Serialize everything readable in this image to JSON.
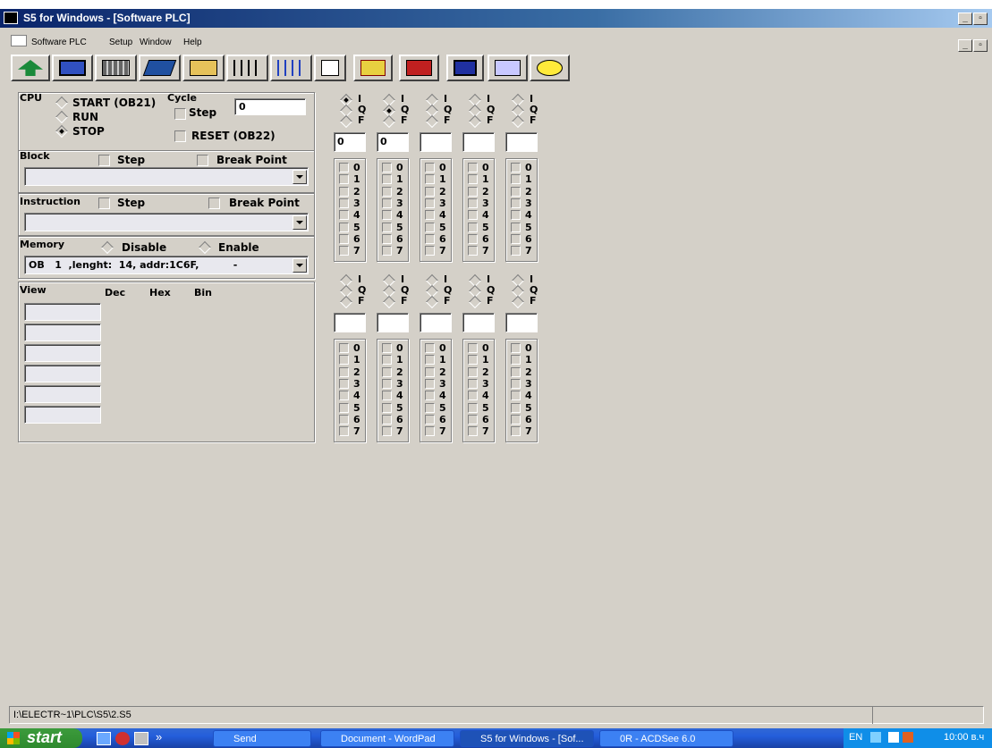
{
  "window": {
    "title": "S5 for Windows - [Software PLC]"
  },
  "menu": [
    "Software PLC",
    "Setup",
    "Window",
    "Help"
  ],
  "toolbar_icons": [
    "upload-icon",
    "monitor-icon",
    "rack-icon",
    "chip-icon",
    "keyboard-icon",
    "ladder-icon",
    "ladder-query-icon",
    "document-icon",
    "crash-icon",
    "query-icon",
    "screen-icon",
    "image-icon",
    "help-icon"
  ],
  "cpu": {
    "label": "CPU",
    "start": "START (OB21)",
    "run": "RUN",
    "stop": "STOP",
    "cycle_label": "Cycle",
    "cycle_value": "0",
    "step": "Step",
    "reset": "RESET (OB22)"
  },
  "block": {
    "label": "Block",
    "step": "Step",
    "break_point": "Break Point",
    "value": ""
  },
  "instruction": {
    "label": "Instruction",
    "step": "Step",
    "break_point": "Break Point",
    "value": ""
  },
  "memory": {
    "label": "Memory",
    "disable": "Disable",
    "enable": "Enable",
    "value": "OB   1  ,lenght:  14, addr:1C6F,          -"
  },
  "view": {
    "label": "View",
    "dec": "Dec",
    "hex": "Hex",
    "bin": "Bin"
  },
  "io_modes": [
    "I",
    "Q",
    "F"
  ],
  "io_bits": [
    "0",
    "1",
    "2",
    "3",
    "4",
    "5",
    "6",
    "7"
  ],
  "io_top": [
    {
      "mode": "I",
      "value": "0"
    },
    {
      "mode": "Q",
      "value": "0"
    },
    {
      "mode": "",
      "value": ""
    },
    {
      "mode": "",
      "value": ""
    },
    {
      "mode": "",
      "value": ""
    }
  ],
  "io_bottom": [
    {
      "mode": "",
      "value": ""
    },
    {
      "mode": "",
      "value": ""
    },
    {
      "mode": "",
      "value": ""
    },
    {
      "mode": "",
      "value": ""
    },
    {
      "mode": "",
      "value": ""
    }
  ],
  "status": {
    "path": "I:\\ELECTR~1\\PLC\\S5\\2.S5"
  },
  "taskbar": {
    "start": "start",
    "items": [
      "Send",
      "Document - WordPad",
      "S5 for Windows - [Sof...",
      "0R - ACDSee 6.0"
    ],
    "lang": "EN",
    "clock": "10:00 в.ч"
  },
  "colors": {
    "face": "#d4d0c8",
    "title": "#0a246a",
    "taskbar": "#245edb"
  }
}
